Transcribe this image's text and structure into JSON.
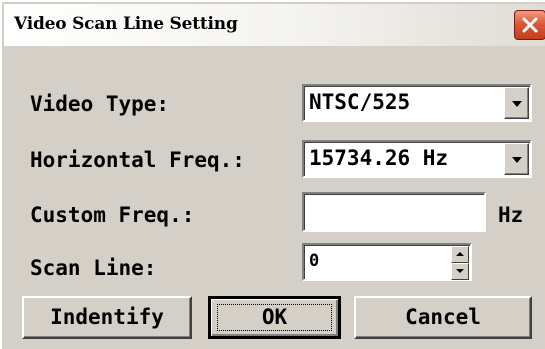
{
  "window": {
    "title": "Video Scan Line Setting",
    "close_icon": "close-x-icon"
  },
  "video_type": {
    "label": "Video Type:",
    "value": "NTSC/525"
  },
  "horizontal_freq": {
    "label": "Horizontal Freq.:",
    "value": "15734.26 Hz"
  },
  "custom_freq": {
    "label": "Custom Freq.:",
    "value": "",
    "unit": "Hz"
  },
  "scan_line": {
    "label": "Scan Line:",
    "value": "0"
  },
  "buttons": {
    "identify": "Indentify",
    "ok": "OK",
    "cancel": "Cancel"
  },
  "colors": {
    "dialog_bg": "#d4d0c8",
    "close_button": "#d95a38"
  }
}
